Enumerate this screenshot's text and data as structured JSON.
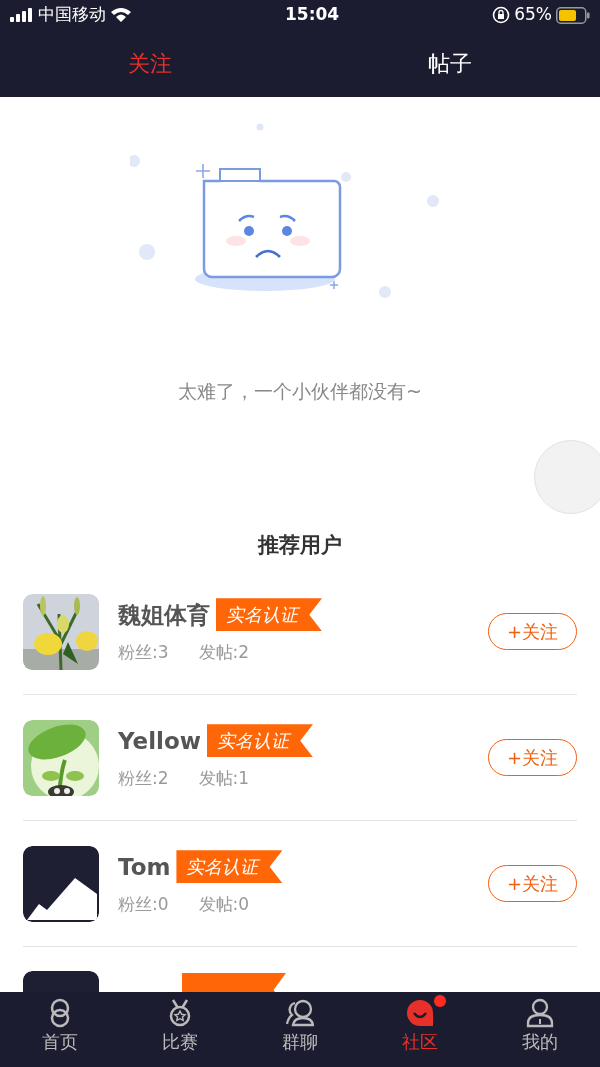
{
  "status_bar": {
    "carrier": "中国移动",
    "time": "15:04",
    "battery": "65%"
  },
  "tabs": [
    {
      "label": "关注",
      "selected": true
    },
    {
      "label": "帖子",
      "selected": false
    }
  ],
  "empty_state": {
    "message": "太难了，一个小伙伴都没有~"
  },
  "recommended": {
    "title": "推荐用户",
    "users": [
      {
        "kind": "full",
        "name": "魏姐体育",
        "badge": "实名认证",
        "fans": "粉丝:3",
        "posts": "发帖:2",
        "button": "+关注"
      },
      {
        "kind": "full",
        "name": "Yellow",
        "badge": "实名认证",
        "fans": "粉丝:2",
        "posts": "发帖:1",
        "button": "+关注"
      },
      {
        "kind": "full",
        "name": "Tom",
        "badge": "实名认证",
        "fans": "粉丝:0",
        "posts": "发帖:0",
        "button": "+关注"
      },
      {
        "kind": "partial"
      }
    ]
  },
  "bottom_nav": [
    {
      "label": "首页",
      "selected": false,
      "dot": false
    },
    {
      "label": "比赛",
      "selected": false,
      "dot": false
    },
    {
      "label": "群聊",
      "selected": false,
      "dot": false
    },
    {
      "label": "社区",
      "selected": true,
      "dot": true
    },
    {
      "label": "我的",
      "selected": false,
      "dot": false
    }
  ]
}
